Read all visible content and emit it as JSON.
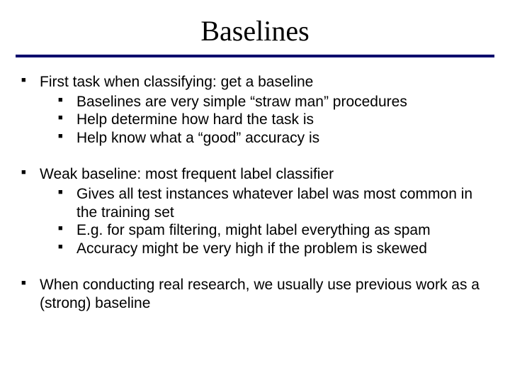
{
  "title": "Baselines",
  "bullets": [
    {
      "text": "First task when classifying: get a baseline",
      "sub": [
        "Baselines are very simple “straw man” procedures",
        "Help determine how hard the task is",
        "Help know what a “good” accuracy is"
      ]
    },
    {
      "text": "Weak baseline: most frequent label classifier",
      "sub": [
        "Gives all test instances whatever label was most common in the training set",
        "E.g. for spam filtering, might label everything as spam",
        "Accuracy might be very high if the problem is skewed"
      ]
    },
    {
      "text": "When conducting real research, we usually use previous work as a (strong) baseline",
      "sub": []
    }
  ]
}
